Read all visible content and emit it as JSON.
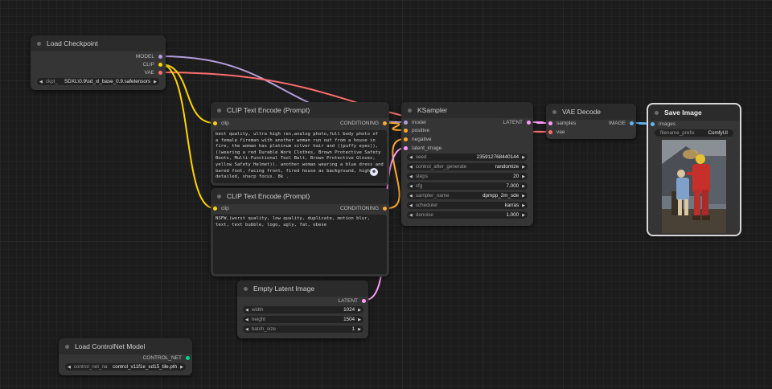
{
  "nodes": {
    "load_checkpoint": {
      "title": "Load Checkpoint",
      "outputs": [
        "MODEL",
        "CLIP",
        "VAE"
      ],
      "ckpt": {
        "label": "ckpt_",
        "value": "SDXL\\0.9\\sd_xl_base_0.9.safetensors"
      }
    },
    "clip_pos": {
      "title": "CLIP Text Encode (Prompt)",
      "input": "clip",
      "output": "CONDITIONING",
      "text": "best quality, ultra high res,analog photo,full body photo of  a female fireman with another woman run out from a house in fire, the woman has platinum silver hair and ((puffy eyes)), ((wearing a red Durable Work Clothes, Brown Protective Safety Boots, Multi-Functional Tool Belt, Brown Protective Gloves, yellow Safety Helmet)). another woman wearing a blue dress and bared foot, facing front, fired house as background, highly detailed, sharp focus. 8k ."
    },
    "clip_neg": {
      "title": "CLIP Text Encode (Prompt)",
      "input": "clip",
      "output": "CONDITIONING",
      "text": "NSFW,(worst quality, low quality, duplicate, motion blur, text, text bubble, logo, ugly, fat, obese"
    },
    "ksampler": {
      "title": "KSampler",
      "inputs": [
        "model",
        "positive",
        "negative",
        "latent_image"
      ],
      "output": "LATENT",
      "widgets": [
        {
          "label": "seed",
          "value": "235912768440144"
        },
        {
          "label": "control_after_generate",
          "value": "randomize"
        },
        {
          "label": "steps",
          "value": "20"
        },
        {
          "label": "cfg",
          "value": "7.000"
        },
        {
          "label": "sampler_name",
          "value": "dpmpp_2m_sde"
        },
        {
          "label": "scheduler",
          "value": "karras"
        },
        {
          "label": "denoise",
          "value": "1.000"
        }
      ]
    },
    "vae_decode": {
      "title": "VAE Decode",
      "inputs": [
        "samples",
        "vae"
      ],
      "output": "IMAGE"
    },
    "save_image": {
      "title": "Save Image",
      "input": "images",
      "filename": {
        "label": "filename_prefix",
        "value": "ComfyUI"
      }
    },
    "empty_latent": {
      "title": "Empty Latent Image",
      "output": "LATENT",
      "widgets": [
        {
          "label": "width",
          "value": "1024"
        },
        {
          "label": "height",
          "value": "1504"
        },
        {
          "label": "batch_size",
          "value": "1"
        }
      ]
    },
    "controlnet": {
      "title": "Load ControlNet Model",
      "output": "CONTROL_NET",
      "widget": {
        "label": "control_net_na",
        "value": "control_v11f1e_sd15_tile.pth"
      }
    }
  },
  "colors": {
    "model": "#b39ddb",
    "clip": "#ffd500",
    "vae": "#ff6e6e",
    "conditioning": "#ffa931",
    "latent": "#ff9cf9",
    "image": "#64b5f6",
    "control_net": "#00d78d"
  }
}
